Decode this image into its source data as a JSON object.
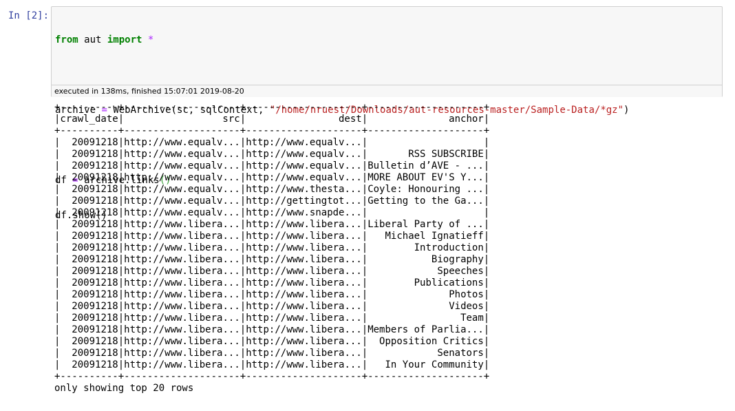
{
  "cell": {
    "prompt": "In [2]:",
    "code": {
      "line1": {
        "kw_from": "from",
        "mod": " aut ",
        "kw_import": "import",
        "sp": " ",
        "star": "*"
      },
      "line3": {
        "var": "archive",
        "eq": " = ",
        "call": "WebArchive(sc, sqlContext, ",
        "str": "\"/home/nruest/Downloads/aut-resources-master/Sample-Data/*gz\"",
        "close": ")"
      },
      "line5": {
        "var": "df",
        "eq": " = ",
        "call": "archive.links",
        "parens": "()"
      },
      "line6": {
        "text": "df.show()"
      }
    },
    "execution": "executed in 138ms, finished 15:07:01 2019-08-20"
  },
  "output": {
    "border": "+----------+--------------------+--------------------+--------------------+",
    "header": "|crawl_date|                 src|                dest|              anchor|",
    "columns": [
      "crawl_date",
      "src",
      "dest",
      "anchor"
    ],
    "rows": [
      [
        "20091218",
        "http://www.equalv...",
        "http://www.equalv...",
        ""
      ],
      [
        "20091218",
        "http://www.equalv...",
        "http://www.equalv...",
        "RSS SUBSCRIBE"
      ],
      [
        "20091218",
        "http://www.equalv...",
        "http://www.equalv...",
        "Bulletin d’AVE - ..."
      ],
      [
        "20091218",
        "http://www.equalv...",
        "http://www.equalv...",
        "MORE ABOUT EV'S Y..."
      ],
      [
        "20091218",
        "http://www.equalv...",
        "http://www.thesta...",
        "Coyle: Honouring ..."
      ],
      [
        "20091218",
        "http://www.equalv...",
        "http://gettingtot...",
        "Getting to the Ga..."
      ],
      [
        "20091218",
        "http://www.equalv...",
        "http://www.snapde...",
        ""
      ],
      [
        "20091218",
        "http://www.libera...",
        "http://www.libera...",
        "Liberal Party of ..."
      ],
      [
        "20091218",
        "http://www.libera...",
        "http://www.libera...",
        "Michael Ignatieff"
      ],
      [
        "20091218",
        "http://www.libera...",
        "http://www.libera...",
        "Introduction"
      ],
      [
        "20091218",
        "http://www.libera...",
        "http://www.libera...",
        "Biography"
      ],
      [
        "20091218",
        "http://www.libera...",
        "http://www.libera...",
        "Speeches"
      ],
      [
        "20091218",
        "http://www.libera...",
        "http://www.libera...",
        "Publications"
      ],
      [
        "20091218",
        "http://www.libera...",
        "http://www.libera...",
        "Photos"
      ],
      [
        "20091218",
        "http://www.libera...",
        "http://www.libera...",
        "Videos"
      ],
      [
        "20091218",
        "http://www.libera...",
        "http://www.libera...",
        "Team"
      ],
      [
        "20091218",
        "http://www.libera...",
        "http://www.libera...",
        "Members of Parlia..."
      ],
      [
        "20091218",
        "http://www.libera...",
        "http://www.libera...",
        "Opposition Critics"
      ],
      [
        "20091218",
        "http://www.libera...",
        "http://www.libera...",
        "Senators"
      ],
      [
        "20091218",
        "http://www.libera...",
        "http://www.libera...",
        "In Your Community"
      ]
    ],
    "footer": "only showing top 20 rows"
  }
}
